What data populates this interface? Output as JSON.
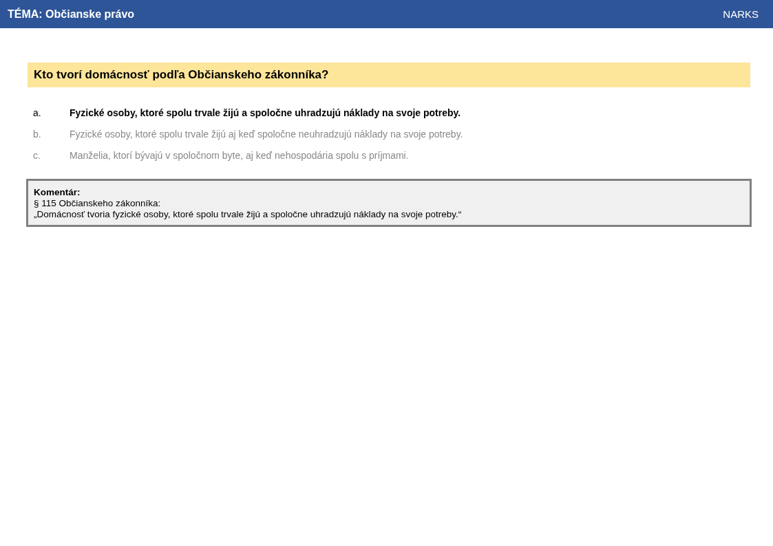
{
  "header": {
    "topic": "TÉMA: Občianske právo",
    "brand": "NARKS"
  },
  "question": "Kto tvorí domácnosť podľa Občianskeho zákonníka?",
  "answers": [
    {
      "letter": "a.",
      "text": "Fyzické osoby, ktoré spolu trvale žijú a spoločne uhradzujú náklady na svoje potreby.",
      "correct": true
    },
    {
      "letter": "b.",
      "text": "Fyzické osoby, ktoré spolu trvale žijú aj keď spoločne neuhradzujú náklady na svoje potreby.",
      "correct": false
    },
    {
      "letter": "c.",
      "text": "Manželia, ktorí bývajú v spoločnom byte, aj keď nehospodária spolu s príjmami.",
      "correct": false
    }
  ],
  "comment": {
    "title": "Komentár:",
    "lines": [
      "§ 115 Občianskeho zákonníka:",
      "„Domácnosť tvoria fyzické osoby, ktoré spolu trvale žijú a spoločne uhradzujú náklady na svoje potreby.“"
    ]
  }
}
